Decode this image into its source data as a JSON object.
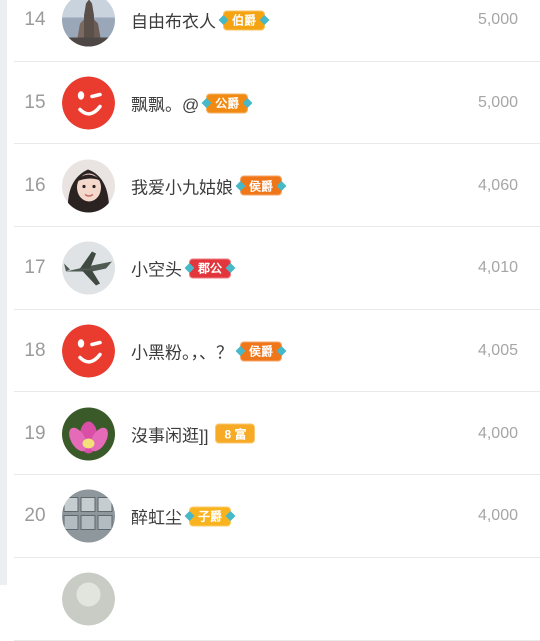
{
  "ranking": {
    "rows": [
      {
        "rank": "14",
        "name": "自由布衣人",
        "badge": "伯爵",
        "badge_color": "#f5a311",
        "score": "5,000",
        "avatar": "stone-statue-avatar"
      },
      {
        "rank": "15",
        "name": "飘飘。@",
        "badge": "公爵",
        "badge_color": "#f08a12",
        "score": "5,000",
        "avatar": "wink-face-avatar"
      },
      {
        "rank": "16",
        "name": "我爱小九姑娘",
        "badge": "侯爵",
        "badge_color": "#f0761a",
        "score": "4,060",
        "avatar": "girl-photo-avatar"
      },
      {
        "rank": "17",
        "name": "小空头",
        "badge": "郡公",
        "badge_color": "#e2363c",
        "score": "4,010",
        "avatar": "fighter-jet-avatar"
      },
      {
        "rank": "18",
        "name": "小黑粉。，、？",
        "badge": "侯爵",
        "badge_color": "#f0761a",
        "score": "4,005",
        "avatar": "wink-face-avatar"
      },
      {
        "rank": "19",
        "name": "沒事闲逛]]",
        "badge": "8 富",
        "badge_color": "#f7aa25",
        "score": "4,000",
        "avatar": "lotus-flower-avatar"
      },
      {
        "rank": "20",
        "name": "醉虹尘",
        "badge": "子爵",
        "badge_color": "#f8b31e",
        "score": "4,000",
        "avatar": "steel-pipes-avatar"
      }
    ]
  }
}
